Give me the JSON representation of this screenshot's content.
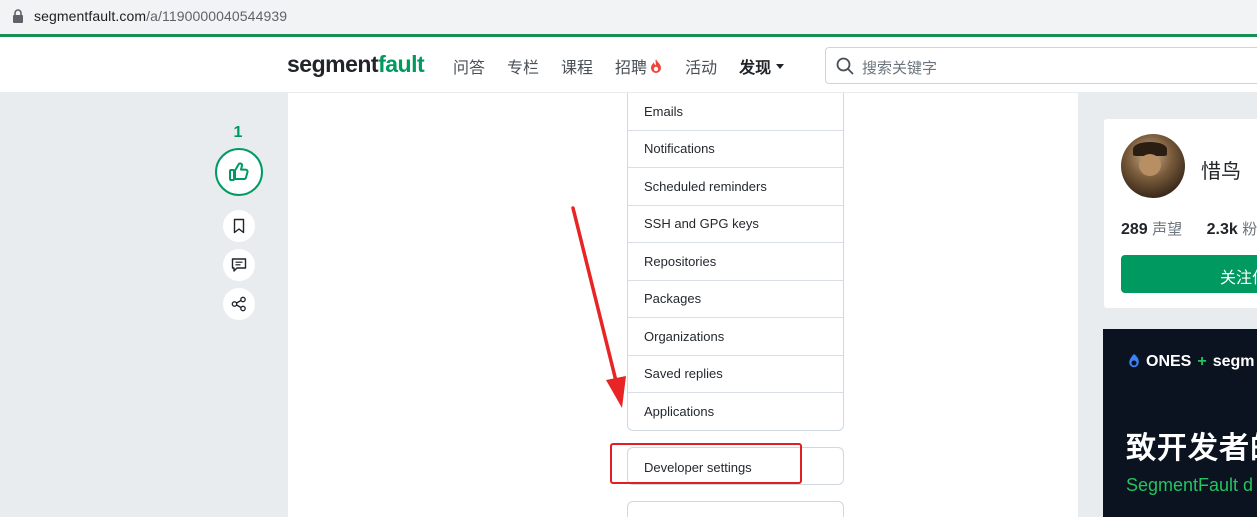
{
  "browser": {
    "url_host": "segmentfault.com",
    "url_path": "/a/1190000040544939"
  },
  "header": {
    "logo_part1": "segment",
    "logo_part2": "fault",
    "nav": [
      {
        "label": "问答"
      },
      {
        "label": "专栏"
      },
      {
        "label": "课程"
      },
      {
        "label": "招聘"
      },
      {
        "label": "活动"
      },
      {
        "label": "发现"
      }
    ],
    "search_placeholder": "搜索关键字"
  },
  "actions": {
    "vote_count": "1"
  },
  "settings_menu": {
    "items": [
      {
        "label": "Emails"
      },
      {
        "label": "Notifications"
      },
      {
        "label": "Scheduled reminders"
      },
      {
        "label": "SSH and GPG keys"
      },
      {
        "label": "Repositories"
      },
      {
        "label": "Packages"
      },
      {
        "label": "Organizations"
      },
      {
        "label": "Saved replies"
      },
      {
        "label": "Applications"
      }
    ],
    "developer_settings": "Developer settings"
  },
  "author": {
    "name": "惜鸟",
    "reputation_value": "289",
    "reputation_label": "声望",
    "followers_value": "2.3k",
    "followers_label": "粉",
    "follow_button": "关注作"
  },
  "ad": {
    "brand": "ONES",
    "plus": "+",
    "partner": "segm",
    "headline": "致开发者的",
    "subline": "SegmentFault d"
  },
  "colors": {
    "brand_green": "#009a61",
    "highlight_red": "#e02020"
  }
}
